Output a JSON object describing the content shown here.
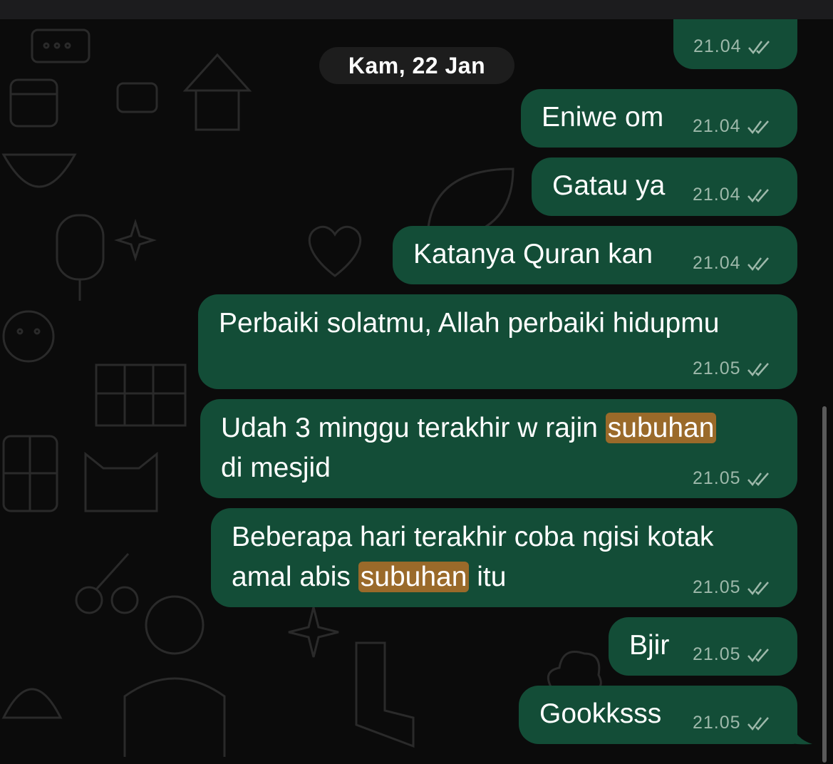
{
  "date_separator": "Kam, 22 Jan",
  "colors": {
    "bubble_outgoing": "#134d37",
    "highlight": "#9a6a2a",
    "chat_background": "#0b0b0b",
    "meta_text": "#9db8aa"
  },
  "messages": [
    {
      "text": "",
      "time": "21.04",
      "status_icon": "double-check-icon"
    },
    {
      "text": "Eniwe om",
      "time": "21.04",
      "status_icon": "double-check-icon"
    },
    {
      "text": "Gatau ya",
      "time": "21.04",
      "status_icon": "double-check-icon"
    },
    {
      "text": "Katanya Quran kan",
      "time": "21.04",
      "status_icon": "double-check-icon"
    },
    {
      "text": "Perbaiki solatmu, Allah perbaiki hidupmu",
      "time": "21.05",
      "status_icon": "double-check-icon"
    },
    {
      "line1_before": "Udah 3 minggu terakhir w rajin ",
      "line1_highlight": "subuhan",
      "line2": "di mesjid",
      "time": "21.05",
      "status_icon": "double-check-icon"
    },
    {
      "line1": "Beberapa hari terakhir coba ngisi kotak",
      "line2_before": "amal abis ",
      "line2_highlight": "subuhan",
      "line2_after": " itu",
      "time": "21.05",
      "status_icon": "double-check-icon"
    },
    {
      "text": "Bjir",
      "time": "21.05",
      "status_icon": "double-check-icon"
    },
    {
      "text": "Gookksss",
      "time": "21.05",
      "status_icon": "double-check-icon"
    }
  ]
}
